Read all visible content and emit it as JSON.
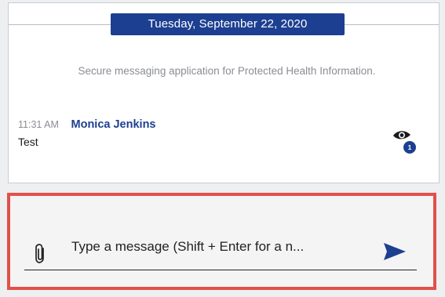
{
  "conversation": {
    "date_divider": "Tuesday, September 22, 2020",
    "notice": "Secure messaging application for Protected Health Information.",
    "messages": [
      {
        "time": "11:31 AM",
        "sender": "Monica Jenkins",
        "text": "Test",
        "read_count": "1",
        "read_icon": "eye-icon"
      }
    ]
  },
  "composer": {
    "placeholder": "Type a message (Shift + Enter for a n...",
    "attach_icon": "paperclip-icon",
    "send_icon": "send-icon"
  },
  "colors": {
    "accent": "#1c3f91",
    "highlight_border": "#e2504a",
    "muted_text": "#8a8d93"
  }
}
